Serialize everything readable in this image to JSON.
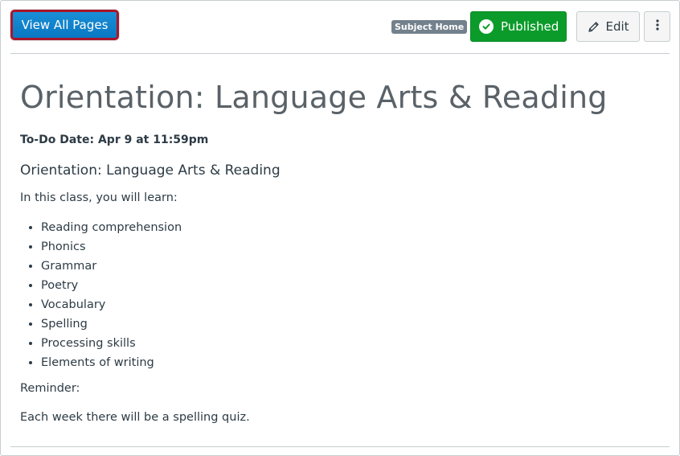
{
  "toolbar": {
    "view_all_pages_label": "View All Pages",
    "subject_home_label": "Subject Home",
    "published_label": "Published",
    "edit_label": "Edit"
  },
  "page": {
    "title": "Orientation: Language Arts & Reading",
    "todo_date": "To-Do Date: Apr 9 at 11:59pm",
    "subheading": "Orientation: Language Arts & Reading",
    "intro": "In this class, you will learn:",
    "topics": [
      "Reading comprehension",
      "Phonics",
      "Grammar",
      "Poetry",
      "Vocabulary",
      "Spelling",
      "Processing skills",
      "Elements of writing"
    ],
    "reminder_label": "Reminder:",
    "reminder_text": "Each week there will be a spelling quiz."
  },
  "colors": {
    "primary_button": "#0a77c2",
    "focus_ring": "#a8162a",
    "published": "#0b9b2a",
    "badge": "#73818c",
    "title_text": "#5a6268",
    "body_text": "#2d3b45"
  },
  "icons": {
    "published": "check-circle-icon",
    "edit": "pencil-icon",
    "more": "kebab-menu-icon"
  }
}
